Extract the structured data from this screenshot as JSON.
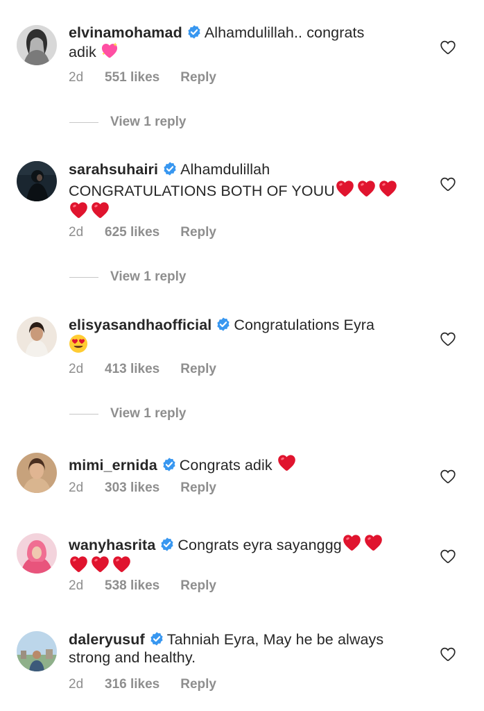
{
  "comments": [
    {
      "username": "elvinamohamad",
      "text_line1": "Alhamdulillah.. congrats",
      "text_line2": "adik",
      "time": "2d",
      "likes": "551 likes",
      "reply": "Reply",
      "view_replies": "View 1 reply"
    },
    {
      "username": "sarahsuhairi",
      "text_line1": "Alhamdulillah",
      "text_line2": "CONGRATULATIONS BOTH OF YOUU",
      "time": "2d",
      "likes": "625 likes",
      "reply": "Reply",
      "view_replies": "View 1 reply"
    },
    {
      "username": "elisyasandhaofficial",
      "text_line1": "Congratulations Eyra",
      "time": "2d",
      "likes": "413 likes",
      "reply": "Reply",
      "view_replies": "View 1 reply"
    },
    {
      "username": "mimi_ernida",
      "text_line1": "Congrats adik",
      "time": "2d",
      "likes": "303 likes",
      "reply": "Reply"
    },
    {
      "username": "wanyhasrita",
      "text_line1": "Congrats eyra sayanggg",
      "time": "2d",
      "likes": "538 likes",
      "reply": "Reply"
    },
    {
      "username": "daleryusuf",
      "text_line1": "Tahniah Eyra, May he be always",
      "text_line2": "strong and healthy.",
      "time": "2d",
      "likes": "316 likes",
      "reply": "Reply"
    }
  ],
  "colors": {
    "text": "#262626",
    "secondary": "#8e8e8e",
    "verified_badge": "#3897f0",
    "heart_emoji": "#e0142e"
  },
  "icons": {
    "verified": "verified-badge-icon",
    "like": "heart-outline-icon",
    "emoji_heart": "red-heart-emoji",
    "emoji_sparkle": "sparkling-heart-emoji",
    "emoji_eyes": "heart-eyes-emoji"
  }
}
